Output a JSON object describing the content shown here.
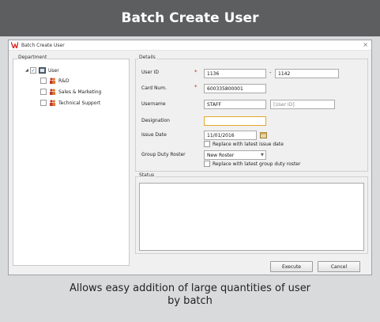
{
  "banner": {
    "title": "Batch Create User"
  },
  "window": {
    "title": "Batch Create User",
    "close_glyph": "×"
  },
  "department": {
    "group_label": "Department",
    "tree": [
      {
        "label": "User",
        "checked": true,
        "expanded": true,
        "icon": "user-card-icon"
      },
      {
        "label": "R&D",
        "checked": false,
        "icon": "people-group-icon"
      },
      {
        "label": "Sales & Marketing",
        "checked": false,
        "icon": "people-group-icon"
      },
      {
        "label": "Technical Support",
        "checked": false,
        "icon": "people-group-icon"
      }
    ]
  },
  "details": {
    "group_label": "Details",
    "required_mark": "*",
    "user_id": {
      "label": "User ID",
      "from": "1136",
      "dash": "-",
      "to": "1142"
    },
    "card_num": {
      "label": "Card Num.",
      "value": "600335800001"
    },
    "username": {
      "label": "Username",
      "value": "STAFF",
      "suffix_placeholder": "[User ID]"
    },
    "designation": {
      "label": "Designation",
      "value": ""
    },
    "issue_date": {
      "label": "Issue Date",
      "value": "11/01/2016",
      "replace_label": "Replace with latest issue date"
    },
    "group_duty_roster": {
      "label": "Group Duty Roster",
      "value": "New Roster",
      "replace_label": "Replace with latest group duty roster"
    }
  },
  "status": {
    "group_label": "Status",
    "text": ""
  },
  "buttons": {
    "execute": "Execute",
    "cancel": "Cancel"
  },
  "caption": {
    "line1": "Allows easy addition of large quantities of user",
    "line2": "by batch"
  },
  "colors": {
    "banner": "#5d5e60",
    "required": "#d02020",
    "focus": "#e4a72c"
  }
}
